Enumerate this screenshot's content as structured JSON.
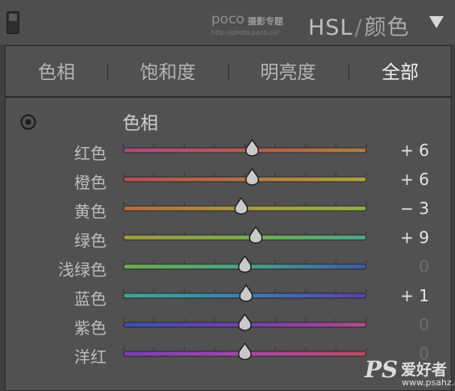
{
  "header": {
    "watermark": {
      "brand": "poco",
      "brand_cn": "摄影专题",
      "url": "http://photo.poco.cn/"
    },
    "title_main": "HSL",
    "title_sep": "/",
    "title_sub": "颜色",
    "menu_icon": "triangle-down-icon"
  },
  "tabs": [
    {
      "label": "色相",
      "active": false
    },
    {
      "label": "饱和度",
      "active": false
    },
    {
      "label": "明亮度",
      "active": false
    },
    {
      "label": "全部",
      "active": true
    }
  ],
  "section": {
    "title": "色相",
    "target_icon": "target-adjust-icon"
  },
  "slider_range": [
    -100,
    100
  ],
  "rows": [
    {
      "label": "红色",
      "value": 6,
      "display": "+ 6",
      "gradient": [
        "#b0467f",
        "#b75a4e",
        "#a97d43"
      ]
    },
    {
      "label": "橙色",
      "value": 6,
      "display": "+ 6",
      "gradient": [
        "#b04d5a",
        "#b37443",
        "#a9a53f"
      ]
    },
    {
      "label": "黄色",
      "value": -3,
      "display": "− 3",
      "gradient": [
        "#b66a3e",
        "#a69a3e",
        "#8fae48"
      ]
    },
    {
      "label": "绿色",
      "value": 9,
      "display": "+ 9",
      "gradient": [
        "#a39c40",
        "#7aae4f",
        "#47a98a"
      ]
    },
    {
      "label": "浅绿色",
      "value": 0,
      "display": "0",
      "gradient": [
        "#6eab4e",
        "#4aa58c",
        "#3d5aaa"
      ]
    },
    {
      "label": "蓝色",
      "value": 1,
      "display": "+ 1",
      "gradient": [
        "#3fa791",
        "#3a7fb3",
        "#5a3fae"
      ]
    },
    {
      "label": "紫色",
      "value": 0,
      "display": "0",
      "gradient": [
        "#3b4fb0",
        "#7041b0",
        "#b64a8a"
      ]
    },
    {
      "label": "洋红",
      "value": 0,
      "display": "0",
      "gradient": [
        "#7841b2",
        "#a547a7",
        "#b64b63"
      ]
    }
  ],
  "bottom_watermark": {
    "ps": "PS",
    "cn": "爱好者",
    "domain": "www.psahz.com"
  },
  "colors": {
    "panel_bg": "#515151",
    "header_bg": "#4e4e4e",
    "text": "#bdbdbd",
    "active_tab": "#efefef",
    "zero_value": "#6f6f6f",
    "thumb": "#c9c9c9"
  }
}
